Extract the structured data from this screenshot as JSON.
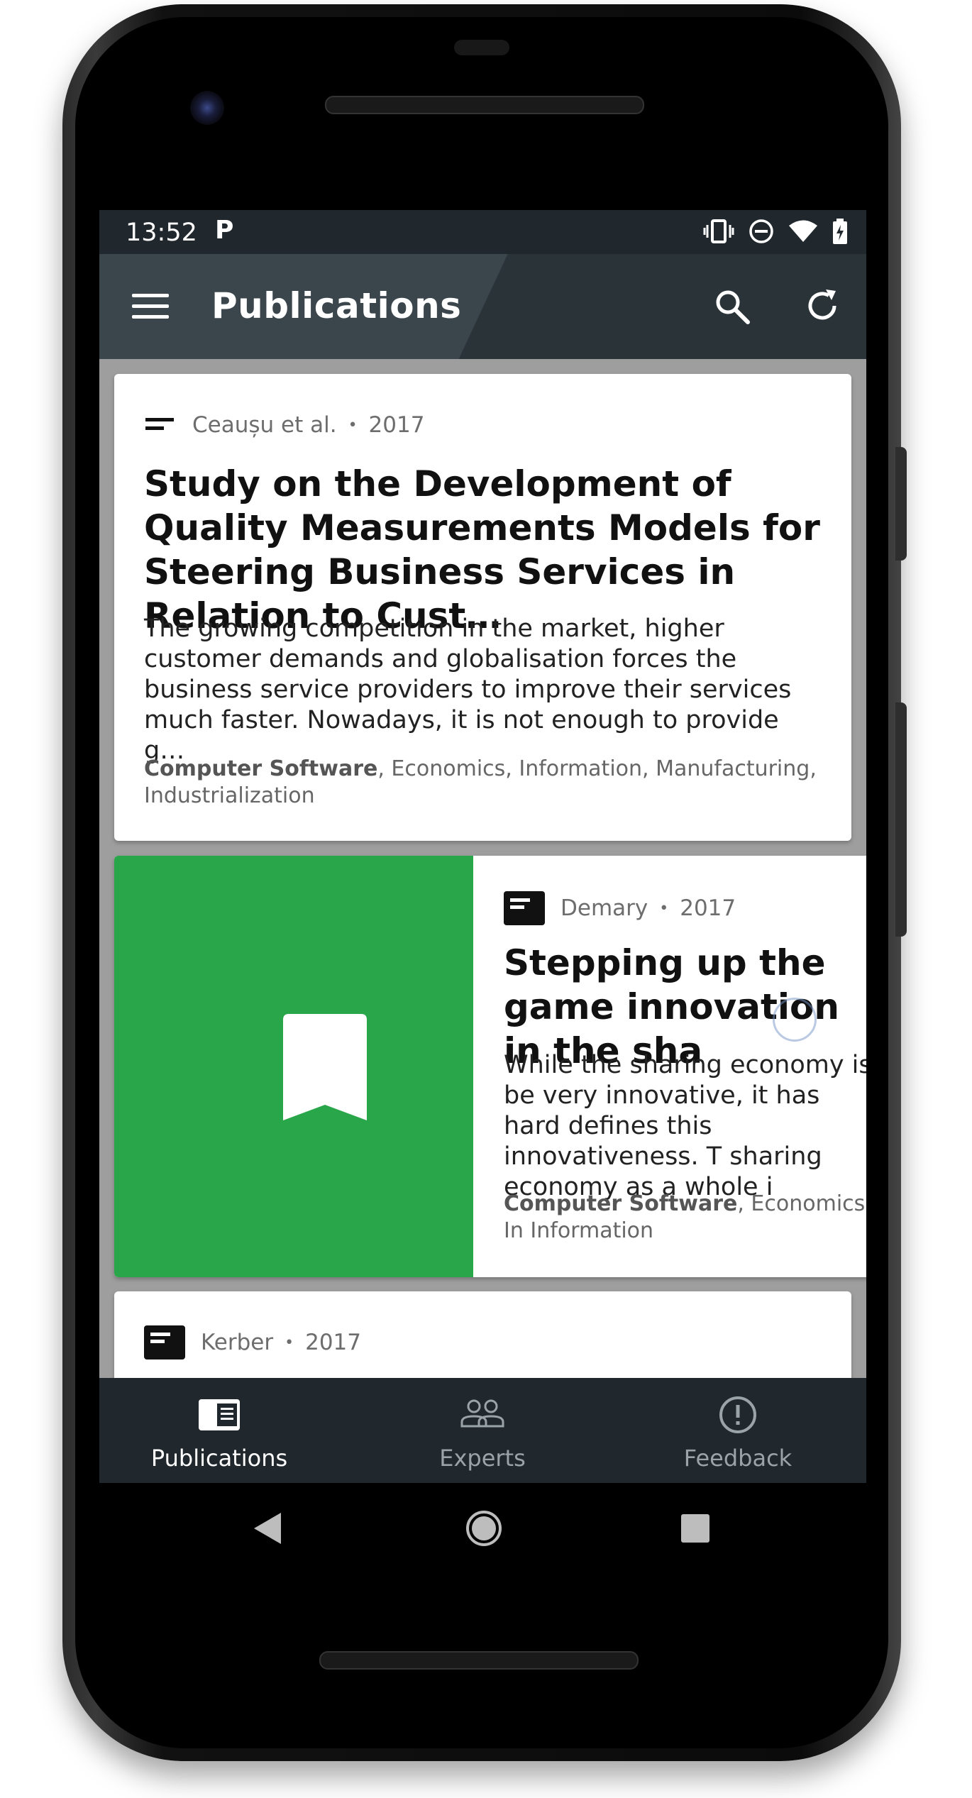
{
  "status_bar": {
    "time": "13:52",
    "notif_icon": "P",
    "icons": [
      "vibrate-icon",
      "dnd-icon",
      "wifi-icon",
      "battery-icon"
    ]
  },
  "app_bar": {
    "title": "Publications"
  },
  "cards": [
    {
      "authors": "Ceaușu et al.",
      "year": "2017",
      "title": "Study on the Development of Quality Measurements Models for Steering Business Services in Relation to Cust…",
      "abstract": "The growing competition in the market, higher customer demands and globalisation forces the business service providers to improve their services much faster. Nowadays, it is not enough to provide g…",
      "keyword_primary": "Computer Software",
      "keywords_rest": ", Economics, Information, Manufacturing, Industrialization"
    },
    {
      "authors": "Demary",
      "year": "2017",
      "title": "Stepping up the game innovation in the sha",
      "abstract": "While the sharing economy is be very innovative, it has hard defines this innovativeness. T sharing economy as a whole i",
      "keyword_primary": "Computer Software",
      "keywords_rest": ", Economics, In Information",
      "thumbnail_color": "#2aa64a"
    },
    {
      "authors": "Kerber",
      "year": "2017"
    }
  ],
  "bottom_nav": {
    "items": [
      {
        "label": "Publications",
        "active": true
      },
      {
        "label": "Experts",
        "active": false
      },
      {
        "label": "Feedback",
        "active": false
      }
    ]
  },
  "colors": {
    "app_bar": "#3b454c",
    "status_bar": "#20282d",
    "accent_green": "#2aa64a"
  }
}
